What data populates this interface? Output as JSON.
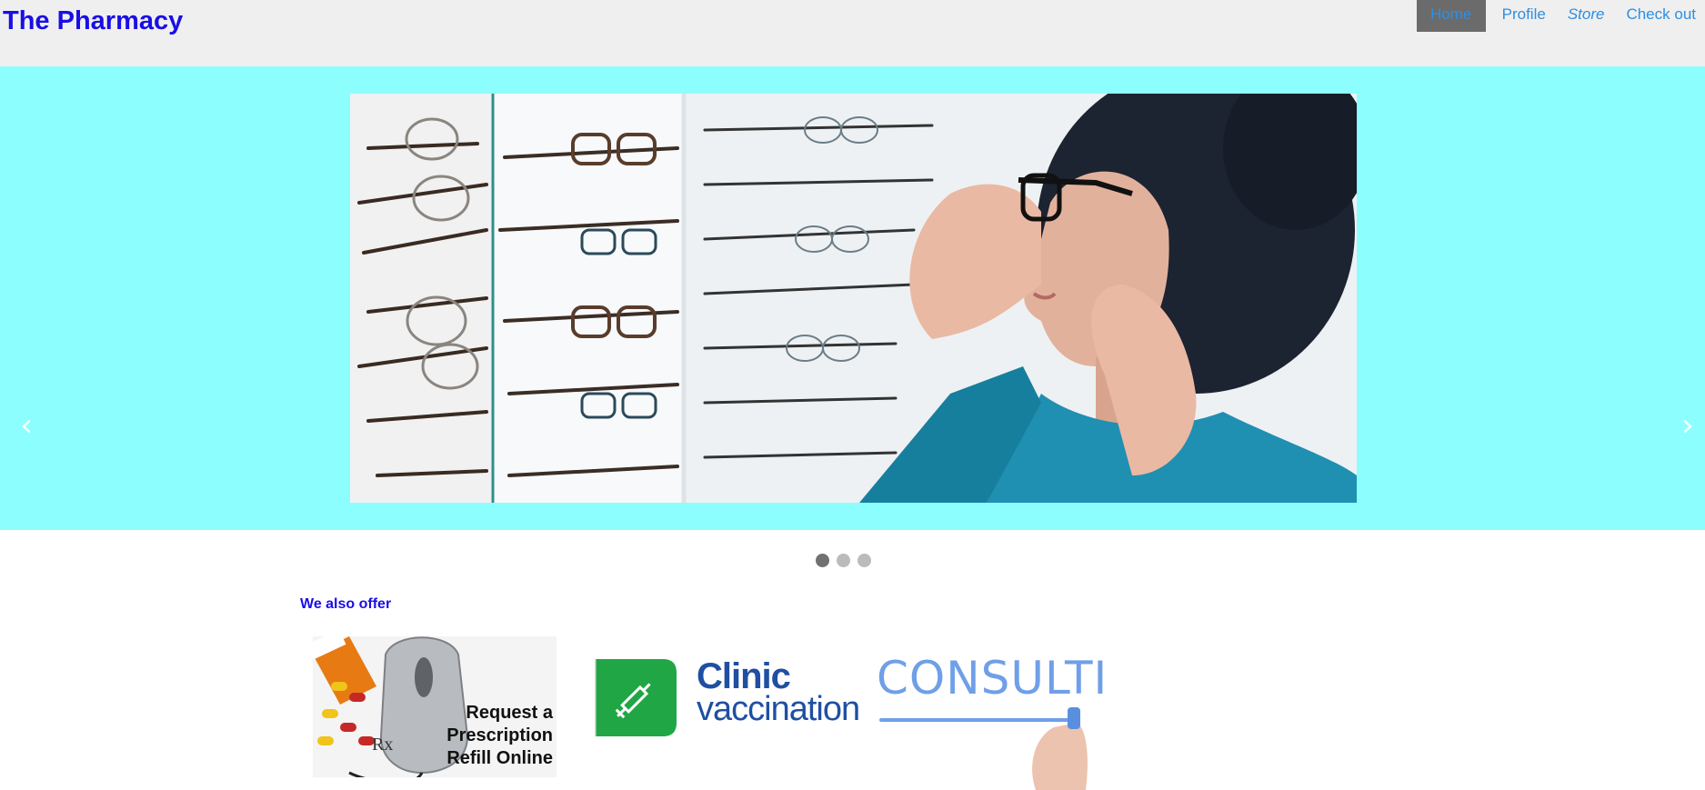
{
  "header": {
    "brand": "The Pharmacy",
    "nav": [
      {
        "label": "Home",
        "active": true
      },
      {
        "label": "Profile",
        "active": false
      },
      {
        "label": "Store",
        "active": false
      },
      {
        "label": "Check out",
        "active": false
      }
    ]
  },
  "carousel": {
    "prev_icon": "chevron-left-icon",
    "next_icon": "chevron-right-icon",
    "prev_glyph": "‹",
    "next_glyph": "›",
    "dots": 3,
    "active_dot": 0,
    "background": "#8cfefe",
    "image_subject": "woman trying on eyeglasses"
  },
  "offers": {
    "title": "We also offer",
    "items": [
      {
        "lines": [
          "Request a",
          "Prescription",
          "Refill Online"
        ],
        "mark": "Rx"
      },
      {
        "title": "Clinic",
        "subtitle": "vaccination"
      },
      {
        "title": "CONSULTING"
      }
    ]
  },
  "colors": {
    "brand": "#1a0ee6",
    "link": "#2e8fe0",
    "active_nav_bg": "#6b6b6b",
    "header_bg": "#efefef"
  }
}
